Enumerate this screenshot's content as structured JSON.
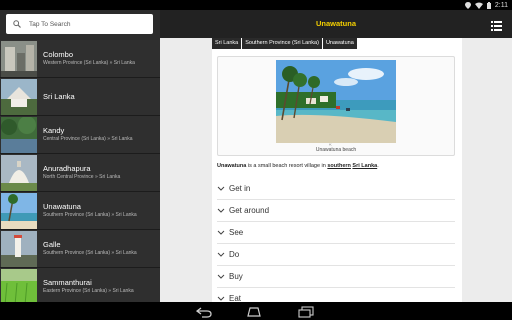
{
  "status_bar": {
    "time": "2:11"
  },
  "search": {
    "placeholder": "Tap To Search"
  },
  "sidebar": {
    "items": [
      {
        "title": "Colombo",
        "subtitle": "Western Province (Sri Lanka) » Sri Lanka"
      },
      {
        "title": "Sri Lanka",
        "subtitle": ""
      },
      {
        "title": "Kandy",
        "subtitle": "Central Province (Sri Lanka) » Sri Lanka"
      },
      {
        "title": "Anuradhapura",
        "subtitle": "North Central Province » Sri Lanka"
      },
      {
        "title": "Unawatuna",
        "subtitle": "Southern Province (Sri Lanka) » Sri Lanka"
      },
      {
        "title": "Galle",
        "subtitle": "Southern Province (Sri Lanka) » Sri Lanka"
      },
      {
        "title": "Sammanthurai",
        "subtitle": "Eastern Province (Sri Lanka) » Sri Lanka"
      }
    ]
  },
  "header": {
    "title": "Unawatuna"
  },
  "breadcrumb": [
    "Sri Lanka",
    "Southern Province (Sri Lanka)",
    "Unawatuna"
  ],
  "article": {
    "image_enlarge": "⇱",
    "caption": "Unawatuna beach",
    "intro_bold": "Unawatuna",
    "intro_mid": " is a small beach resort village in ",
    "link_southern": "southern",
    "intro_space": " ",
    "link_srilanka": "Sri Lanka",
    "intro_end": ".",
    "sections": [
      "Get in",
      "Get around",
      "See",
      "Do",
      "Buy",
      "Eat"
    ]
  },
  "colors": {
    "accent": "#f5d000",
    "topbar": "#222222",
    "drawer": "#2b2b2b"
  }
}
